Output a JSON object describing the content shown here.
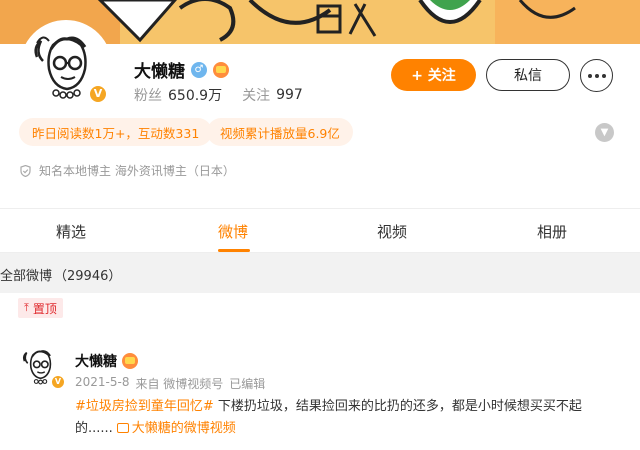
{
  "profile": {
    "name": "大懒糖",
    "gender_icon": "male-symbol",
    "verified_badge": "V",
    "fans_label": "粉丝",
    "fans_count": "650.9万",
    "following_label": "关注",
    "following_count": "997"
  },
  "actions": {
    "follow_label": "+ 关注",
    "message_label": "私信"
  },
  "tags": [
    "昨日阅读数1万+，互动数331",
    "视频累计播放量6.9亿"
  ],
  "identity": "知名本地博主 海外资讯博主（日本）",
  "tabs": [
    {
      "label": "精选"
    },
    {
      "label": "微博"
    },
    {
      "label": "视频"
    },
    {
      "label": "相册"
    }
  ],
  "feed": {
    "all_label": "全部微博",
    "all_count": "（29946）"
  },
  "post": {
    "pinned_label": "置顶",
    "author": "大懒糖",
    "date": "2021-5-8",
    "source": "来自 微博视频号",
    "edited": "已编辑",
    "hashtag": "#垃圾房捡到童年回忆#",
    "text": " 下楼扔垃圾，结果捡回来的比扔的还多，都是小时候想买买不起的......",
    "video_link": "大懒糖的微博视频"
  },
  "colors": {
    "accent": "#ff8200",
    "tag_bg": "#fff2e9",
    "pinned_red": "#e0282c",
    "cover_bg": "#f6c46a"
  }
}
